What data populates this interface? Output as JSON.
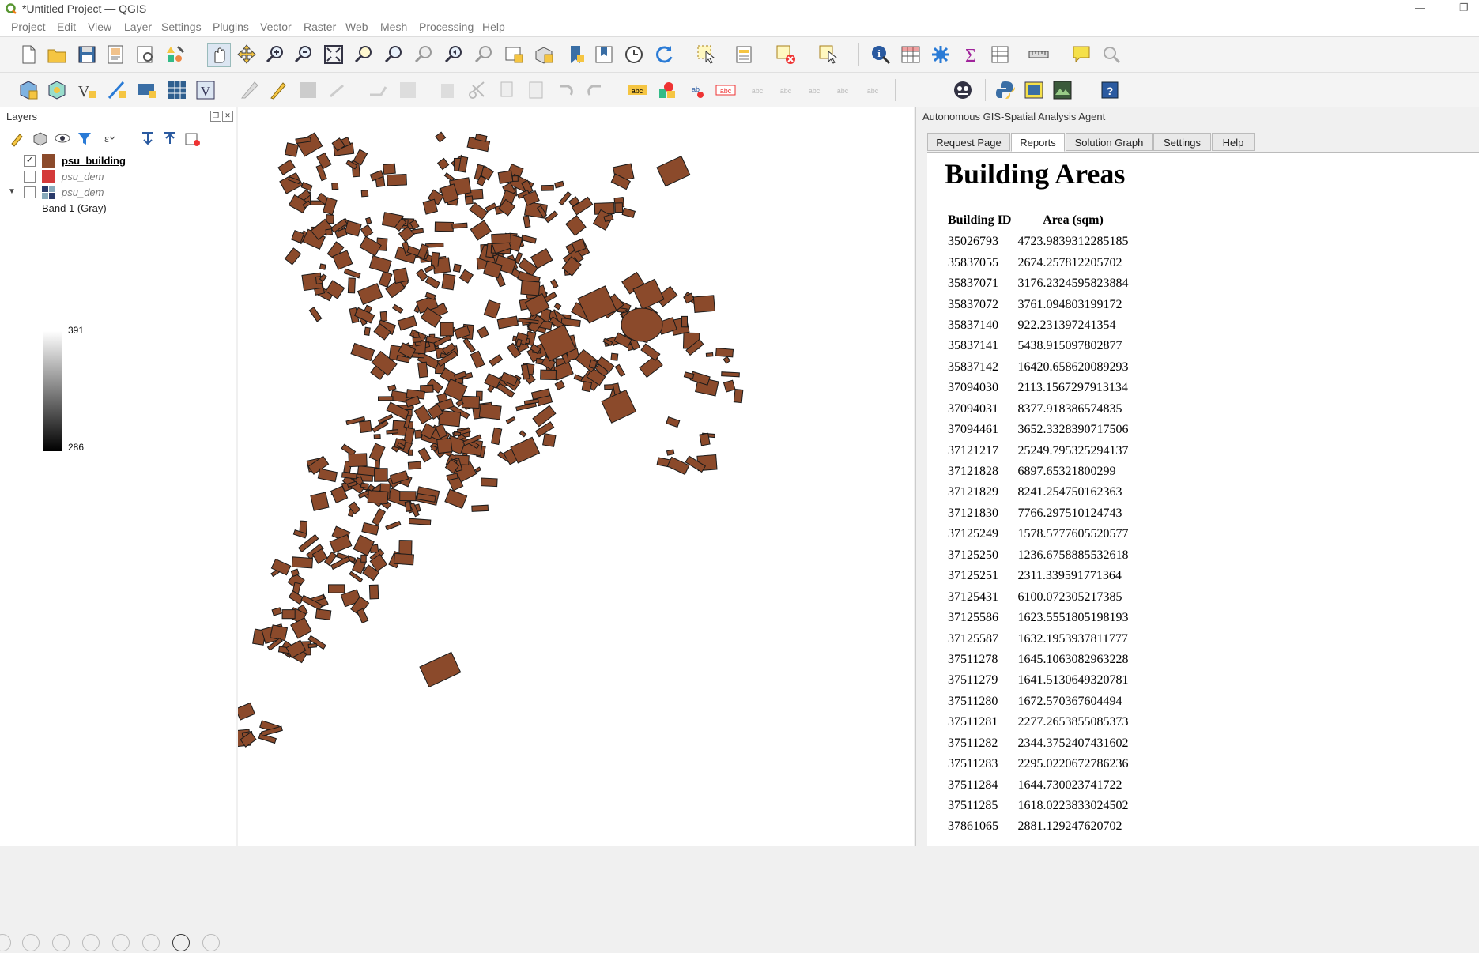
{
  "window": {
    "title": "*Untitled Project — QGIS",
    "minimize": "—",
    "restore": "❐"
  },
  "menu": [
    "Project",
    "Edit",
    "View",
    "Layer",
    "Settings",
    "Plugins",
    "Vector",
    "Raster",
    "Web",
    "Mesh",
    "Processing",
    "Help"
  ],
  "layers_panel": {
    "title": "Layers",
    "layers": [
      {
        "name": "psu_building",
        "checked": true,
        "color": "#8b4a2b",
        "bold": true
      },
      {
        "name": "psu_dem",
        "checked": false,
        "color": "#d43a3a",
        "italic": true
      },
      {
        "name": "psu_dem",
        "checked": false,
        "color": "raster-icon",
        "italic": true,
        "expanded": true
      }
    ],
    "band_label": "Band 1 (Gray)",
    "legend_max": "391",
    "legend_min": "286"
  },
  "map": {
    "building_fill": "#8b4a2b",
    "building_stroke": "#1a1a1a"
  },
  "agent_panel": {
    "title": "Autonomous GIS-Spatial Analysis Agent",
    "tabs": [
      "Request Page",
      "Reports",
      "Solution Graph",
      "Settings",
      "Help"
    ],
    "active_tab": "Reports",
    "report": {
      "heading": "Building Areas",
      "columns": [
        "Building ID",
        "Area (sqm)"
      ],
      "rows": [
        [
          "35026793",
          "4723.9839312285185"
        ],
        [
          "35837055",
          "2674.257812205702"
        ],
        [
          "35837071",
          "3176.2324595823884"
        ],
        [
          "35837072",
          "3761.094803199172"
        ],
        [
          "35837140",
          "922.231397241354"
        ],
        [
          "35837141",
          "5438.915097802877"
        ],
        [
          "35837142",
          "16420.658620089293"
        ],
        [
          "37094030",
          "2113.1567297913134"
        ],
        [
          "37094031",
          "8377.918386574835"
        ],
        [
          "37094461",
          "3652.3328390717506"
        ],
        [
          "37121217",
          "25249.795325294137"
        ],
        [
          "37121828",
          "6897.65321800299"
        ],
        [
          "37121829",
          "8241.254750162363"
        ],
        [
          "37121830",
          "7766.297510124743"
        ],
        [
          "37125249",
          "1578.5777605520577"
        ],
        [
          "37125250",
          "1236.6758885532618"
        ],
        [
          "37125251",
          "2311.339591771364"
        ],
        [
          "37125431",
          "6100.072305217385"
        ],
        [
          "37125586",
          "1623.5551805198193"
        ],
        [
          "37125587",
          "1632.1953937811777"
        ],
        [
          "37511278",
          "1645.1063082963228"
        ],
        [
          "37511279",
          "1641.5130649320781"
        ],
        [
          "37511280",
          "1672.570367604494"
        ],
        [
          "37511281",
          "2277.2653855085373"
        ],
        [
          "37511282",
          "2344.3752407431602"
        ],
        [
          "37511283",
          "2295.0220672786236"
        ],
        [
          "37511284",
          "1644.730023741722"
        ],
        [
          "37511285",
          "1618.0223833024502"
        ],
        [
          "37861065",
          "2881.129247620702"
        ]
      ]
    }
  }
}
